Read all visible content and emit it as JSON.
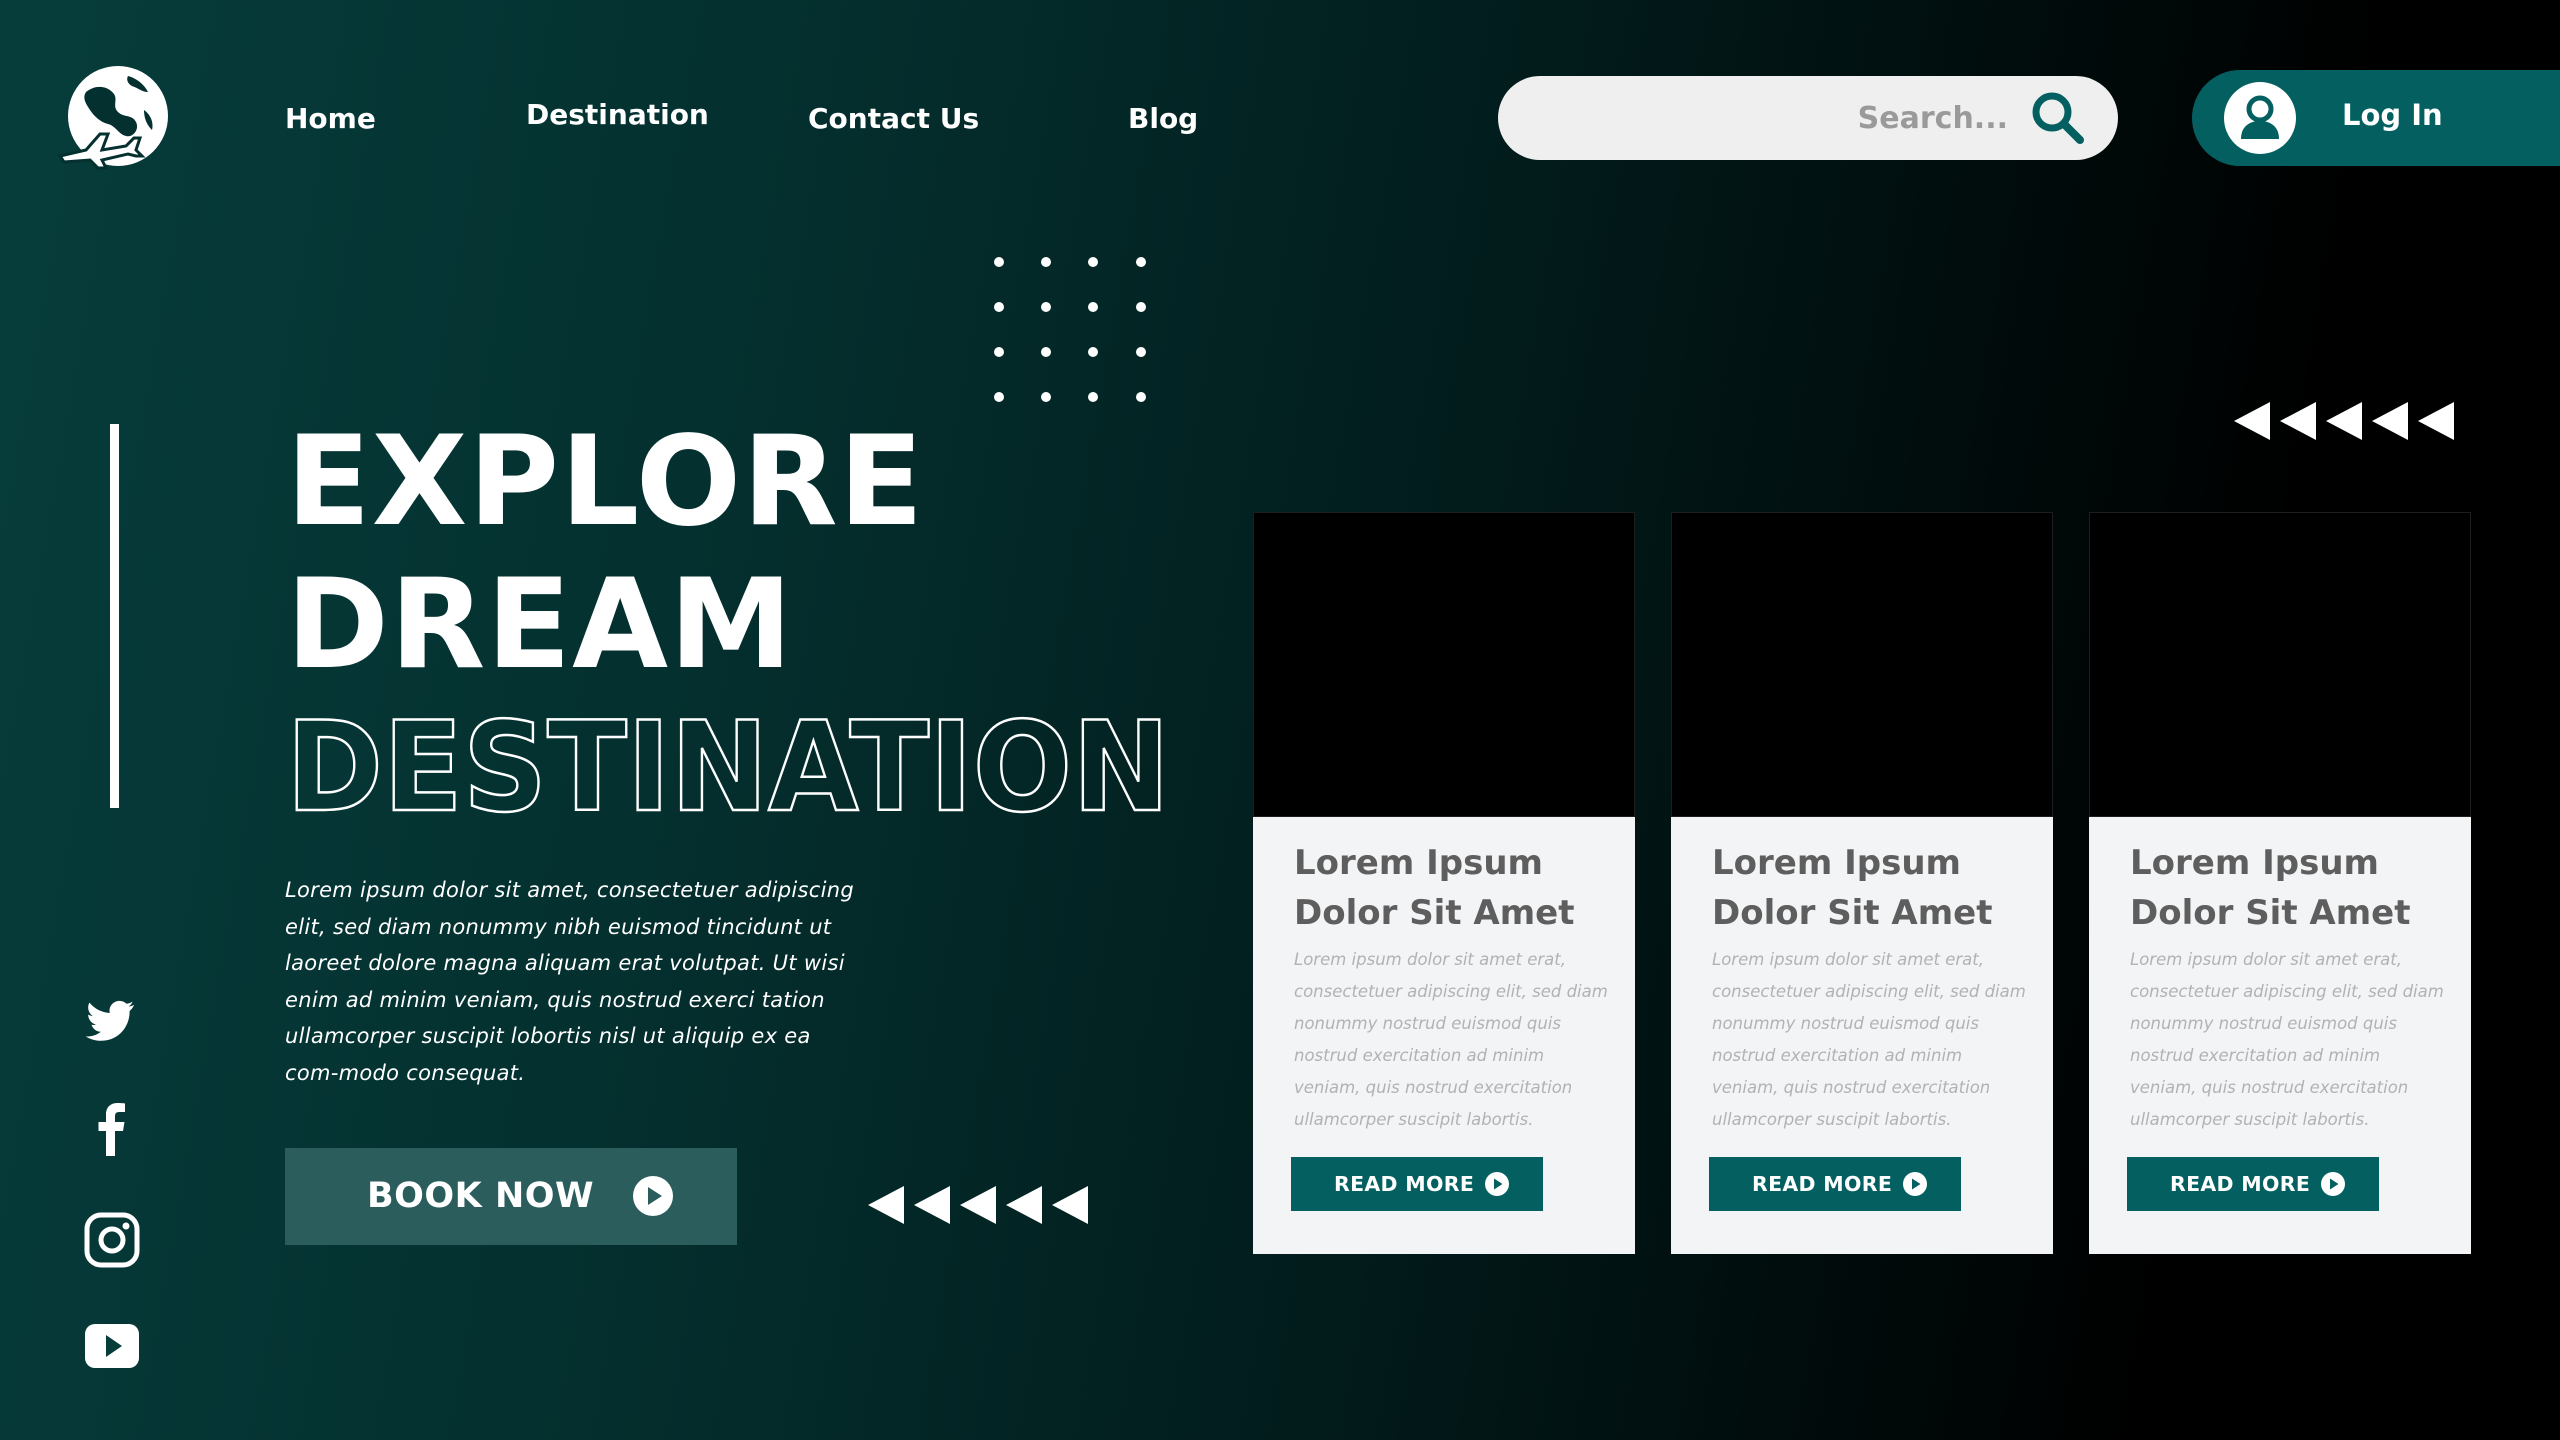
{
  "brand": {
    "logo_icon": "globe-airplane-icon"
  },
  "nav": {
    "items": [
      {
        "label": "Home"
      },
      {
        "label": "Destination"
      },
      {
        "label": "Contact Us"
      },
      {
        "label": "Blog"
      }
    ]
  },
  "search": {
    "placeholder": "Search...",
    "value": "",
    "icon": "search-icon"
  },
  "login": {
    "label": "Log In",
    "icon": "user-icon"
  },
  "hero": {
    "line1": "EXPLORE",
    "line2": "DREAM",
    "line3": "DESTINATION",
    "description": "Lorem ipsum dolor sit amet, consectetuer adipiscing elit, sed diam nonummy nibh euismod tincidunt ut laoreet dolore magna aliquam erat volutpat. Ut wisi enim ad minim veniam, quis nostrud exerci tation ullamcorper suscipit lobortis nisl ut aliquip ex ea com-modo consequat.",
    "book_label": "BOOK NOW"
  },
  "social": [
    "twitter-icon",
    "facebook-icon",
    "instagram-icon",
    "youtube-icon"
  ],
  "cards": [
    {
      "title": "Lorem Ipsum Dolor Sit Amet",
      "text": "Lorem ipsum dolor sit amet erat, consectetuer adipiscing elit, sed diam nonummy nostrud euismod quis nostrud exercitation ad minim veniam, quis nostrud exercitation ullamcorper suscipit labortis.",
      "button": "READ MORE"
    },
    {
      "title": "Lorem Ipsum Dolor Sit Amet",
      "text": "Lorem ipsum dolor sit amet erat, consectetuer adipiscing elit, sed diam nonummy nostrud euismod quis nostrud exercitation ad minim veniam, quis nostrud exercitation ullamcorper suscipit labortis.",
      "button": "READ MORE"
    },
    {
      "title": "Lorem Ipsum Dolor Sit Amet",
      "text": "Lorem ipsum dolor sit amet erat, consectetuer adipiscing elit, sed diam nonummy nostrud euismod quis nostrud exercitation ad minim veniam, quis nostrud exercitation ullamcorper suscipit labortis.",
      "button": "READ MORE"
    }
  ],
  "colors": {
    "accent": "#046060",
    "background_start": "#063d3b",
    "background_end": "#000000",
    "card": "#f3f4f5",
    "book_button": "#2b5d5c"
  }
}
